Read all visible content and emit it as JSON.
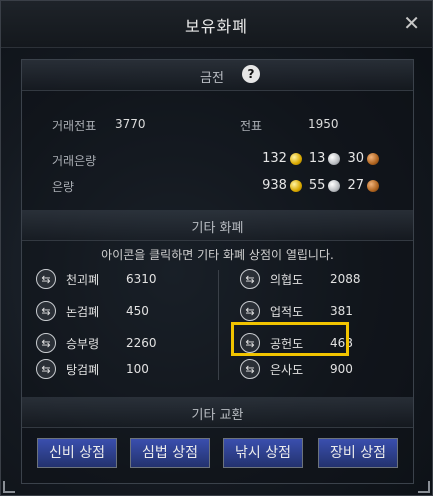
{
  "window": {
    "title": "보유화폐"
  },
  "gold_section": {
    "title": "금전",
    "help": "?",
    "trade_ticket_label": "거래전표",
    "trade_ticket_value": "3770",
    "ticket_label": "전표",
    "ticket_value": "1950",
    "trade_money_label": "거래은량",
    "trade_money": {
      "gold": "132",
      "silver": "13",
      "bronze": "30"
    },
    "money_label": "은량",
    "money": {
      "gold": "938",
      "silver": "55",
      "bronze": "27"
    }
  },
  "other_section": {
    "title": "기타 화폐",
    "hint": "아이콘을 클릭하면 기타 화폐 상점이 열립니다.",
    "left_items": [
      {
        "name": "천괴폐",
        "value": "6310"
      },
      {
        "name": "논검폐",
        "value": "450"
      },
      {
        "name": "승부령",
        "value": "2260"
      },
      {
        "name": "탕검폐",
        "value": "100"
      }
    ],
    "right_items": [
      {
        "name": "의협도",
        "value": "2088"
      },
      {
        "name": "업적도",
        "value": "381"
      },
      {
        "name": "공헌도",
        "value": "468"
      },
      {
        "name": "은사도",
        "value": "900"
      }
    ]
  },
  "exchange_section": {
    "title": "기타 교환",
    "buttons": [
      "신비 상점",
      "심법 상점",
      "낚시 상점",
      "장비 상점"
    ]
  },
  "colors": {
    "highlight": "#f2c400",
    "button": "#2e3f8f"
  }
}
